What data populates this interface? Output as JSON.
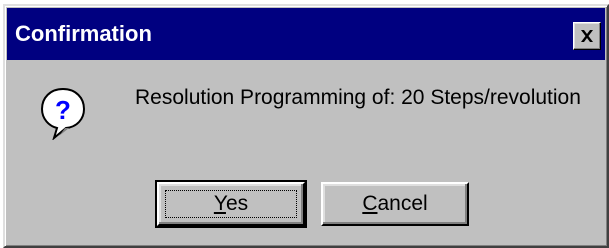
{
  "window": {
    "title": "Confirmation",
    "close_icon": "close-x-icon"
  },
  "dialog": {
    "icon": "question-bubble-icon",
    "message": "Resolution Programming of: 20 Steps/revolution"
  },
  "buttons": {
    "yes": {
      "mnemonic": "Y",
      "rest": "es"
    },
    "cancel": {
      "mnemonic": "C",
      "rest": "ancel"
    }
  },
  "colors": {
    "titlebar": "#000080",
    "face": "#c0c0c0",
    "icon_blue": "#0000ff"
  }
}
